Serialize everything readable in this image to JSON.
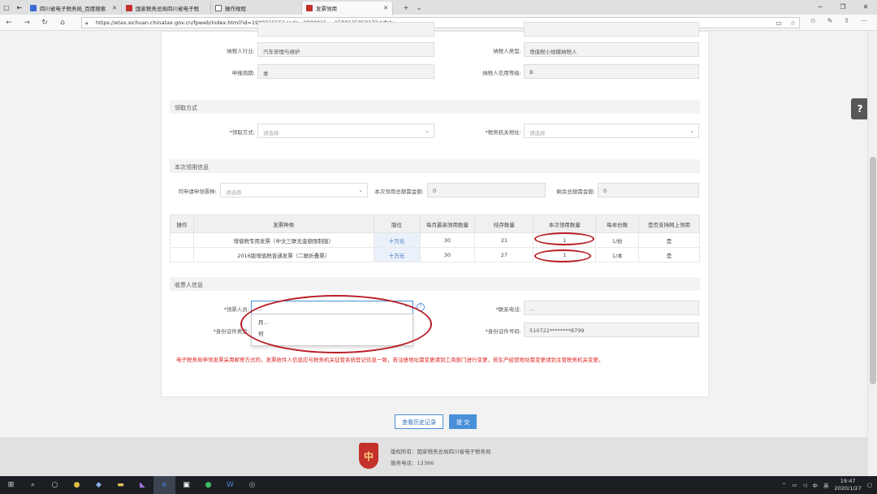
{
  "browser": {
    "tabs": [
      {
        "label": "四川省电子税务局_百度搜索",
        "icon_color": "#3a6ad6"
      },
      {
        "label": "国家税务总局四川省电子税",
        "icon_color": "#c4312b"
      },
      {
        "label": "操作规程",
        "icon_color": "#666666"
      },
      {
        "label": "发票领用",
        "icon_color": "#c4312b"
      }
    ],
    "url": "https://etax.sichuan.chinatax.gov.cn/fpweb/index.html?id=190821555&code=200002&_=1580125059172#/fply",
    "icons": [
      "back-icon",
      "forward-icon",
      "refresh-icon",
      "home-icon",
      "lock-icon",
      "reading-view-icon",
      "favorite-star-icon",
      "favorites-hub-icon",
      "notes-icon",
      "share-icon",
      "more-icon"
    ]
  },
  "taxpayer": {
    "industry_label": "纳税人行业:",
    "industry_value": "汽车修理与维护",
    "type_label": "纳税人类型:",
    "type_value": "增值税小规模纳税人",
    "period_label": "申报周期:",
    "period_value": "季",
    "credit_label": "纳税人信用等级:",
    "credit_value": "B"
  },
  "receive_method": {
    "section_title": "领取方式",
    "method_label": "*领取方式:",
    "method_placeholder": "请选择",
    "office_label": "*税务机关地址:",
    "office_placeholder": "请选择"
  },
  "claim_info": {
    "section_title": "本次领用信息",
    "type_label": "可申请申领票种:",
    "type_placeholder": "请选择",
    "amount_label": "本次领用总额需金额:",
    "amount_value": "0",
    "unused_label": "剩余总额需金额:",
    "unused_value": "0"
  },
  "invoice_table": {
    "headers": [
      "操作",
      "发票种类",
      "版位",
      "每月最高领用数量",
      "结存数量",
      "本次领用数量",
      "每本份数",
      "是否支持网上领用"
    ],
    "rows": [
      {
        "op": "",
        "kind": "增值税专用发票（中文三联无金额限制版）",
        "ver": "十万元",
        "max": "30",
        "stock": "21",
        "qty": "1",
        "per": "1/份",
        "online": "是"
      },
      {
        "op": "",
        "kind": "2016版增值税普通发票（二联折叠票）",
        "ver": "十万元",
        "max": "30",
        "stock": "27",
        "qty": "1",
        "per": "1/本",
        "online": "是"
      }
    ]
  },
  "receiver": {
    "section_title": "收票人信息",
    "person_label": "*领票人员:",
    "person_value": "…",
    "id_type_label": "*身份证件类型:",
    "phone_label": "*联系电话:",
    "phone_value": "…",
    "id_no_label": "*身份证件号码:",
    "id_no_value": "510722********8799",
    "dropdown_options": [
      "月…",
      "何"
    ]
  },
  "notice": "电子税务局申领发票采用邮寄方式的，发票收件人信息应与税务机关征管系统登记信息一致，若注册地址需变更请到工商部门进行变更，若生产经营地址需变更请到主管税务机关变更。",
  "buttons": {
    "history": "查看历史记录",
    "submit": "提 交"
  },
  "footer": {
    "copyright": "版权所有：国家税务总局四川省电子税务局",
    "phone": "服务电话：12366",
    "logo_text": "中"
  },
  "help_label": "?",
  "taskbar": {
    "tray_lang": "中",
    "tray_ime": "英",
    "time": "19:47",
    "date": "2020/1/27"
  },
  "colors": {
    "accent": "#4a90d9",
    "annotation": "#b81d26",
    "notice": "#dd2222"
  }
}
